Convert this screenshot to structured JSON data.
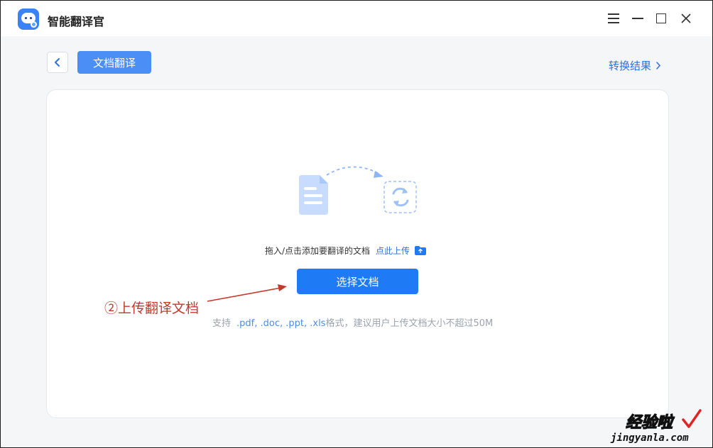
{
  "app": {
    "title": "智能翻译官"
  },
  "window_controls": [
    "menu-icon",
    "minimize-icon",
    "maximize-icon",
    "close-icon"
  ],
  "toolbar": {
    "active_tab": "文档翻译",
    "result_link": "转换结果"
  },
  "upload": {
    "drop_hint": "拖入/点击添加要翻译的文档",
    "upload_link": "点此上传",
    "select_button": "选择文档",
    "support_prefix": "支持",
    "support_formats": ".pdf, .doc, .ppt, .xls",
    "support_suffix": "格式，建议用户上传文档大小不超过50M"
  },
  "annotation": {
    "text": "②上传翻译文档"
  },
  "watermark": {
    "title": "经验啦",
    "url": "jingyanla.com"
  },
  "colors": {
    "primary": "#1f7bf5",
    "tab": "#4b8ef6",
    "link": "#2f6fde",
    "annotation": "#c0392b",
    "background": "#f5f6f8"
  }
}
